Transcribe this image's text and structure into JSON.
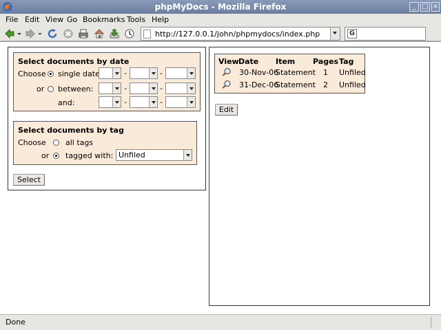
{
  "window": {
    "title": "phpMyDocs - Mozilla Firefox"
  },
  "menu": {
    "items": [
      {
        "label": "File"
      },
      {
        "label": "Edit"
      },
      {
        "label": "View"
      },
      {
        "label": "Go"
      },
      {
        "label": "Bookmarks"
      },
      {
        "label": "Tools"
      },
      {
        "label": "Help"
      }
    ]
  },
  "toolbar": {
    "icons": [
      "back-icon",
      "forward-icon",
      "reload-icon",
      "stop-icon",
      "print-icon",
      "home-icon",
      "download-icon",
      "history-icon"
    ],
    "url": "http://127.0.0.1/john/phpmydocs/index.php"
  },
  "date_filter": {
    "title": "Select documents by date",
    "choose": "Choose",
    "single_date": "single date:",
    "or": "or",
    "between": "between:",
    "and": "and:",
    "sep": "-"
  },
  "tag_filter": {
    "title": "Select documents by tag",
    "choose": "Choose",
    "all_tags": "all tags",
    "or": "or",
    "tagged_with": "tagged with:",
    "tag_value": "Unfiled"
  },
  "select_button": "Select",
  "documents": {
    "headers": {
      "view": "View",
      "date": "Date",
      "item": "Item",
      "pages": "Pages",
      "tag": "Tag"
    },
    "rows": [
      {
        "date": "30-Nov-06",
        "item": "Statement",
        "pages": "1",
        "tag": "Unfiled"
      },
      {
        "date": "31-Dec-06",
        "item": "Statement",
        "pages": "2",
        "tag": "Unfiled"
      }
    ]
  },
  "edit_button": "Edit",
  "status": {
    "text": "Done"
  },
  "colors": {
    "fieldset_bg": "#f9ead9",
    "titlebar": "#7587a8"
  }
}
